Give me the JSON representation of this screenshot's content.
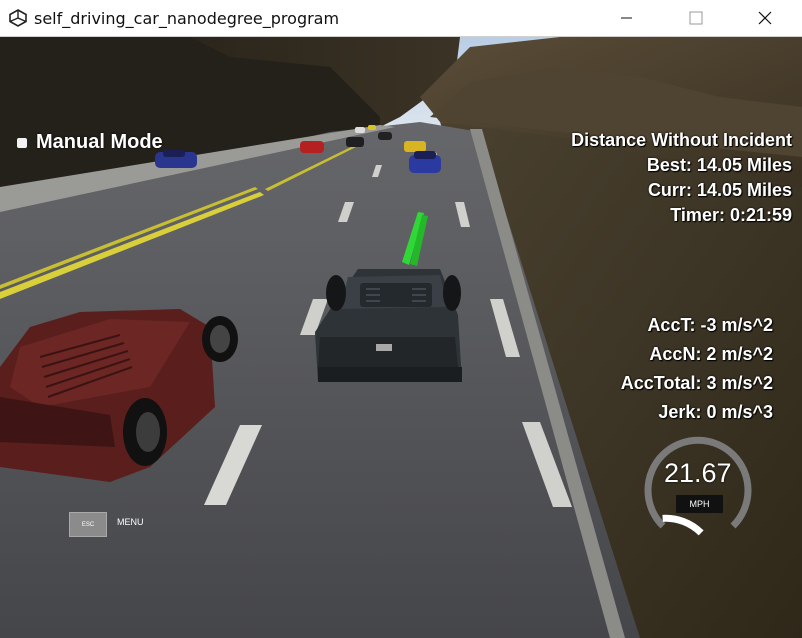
{
  "window": {
    "title": "self_driving_car_nanodegree_program",
    "minimize_label": "minimize",
    "maximize_label": "maximize",
    "close_label": "close"
  },
  "hud": {
    "manual_mode_label": "Manual Mode",
    "distance_heading": "Distance Without Incident",
    "best": "Best: 14.05 Miles",
    "curr": "Curr: 14.05 Miles",
    "timer": "Timer: 0:21:59",
    "acc_t": "AccT: -3 m/s^2",
    "acc_n": "AccN: 2 m/s^2",
    "acc_total": "AccTotal: 3 m/s^2",
    "jerk": "Jerk: 0 m/s^3"
  },
  "speedometer": {
    "value": "21.67",
    "unit": "MPH",
    "fill_fraction": 0.18
  },
  "menu": {
    "esc_label": "ESC",
    "menu_label": "MENU"
  },
  "colors": {
    "road": "#4c4d50",
    "lane_yellow": "#d8cf3a",
    "path_green": "#2fd836",
    "sky": "#c9d7ea",
    "ego_car": "#2e3338",
    "red_car": "#5a1e1c"
  }
}
